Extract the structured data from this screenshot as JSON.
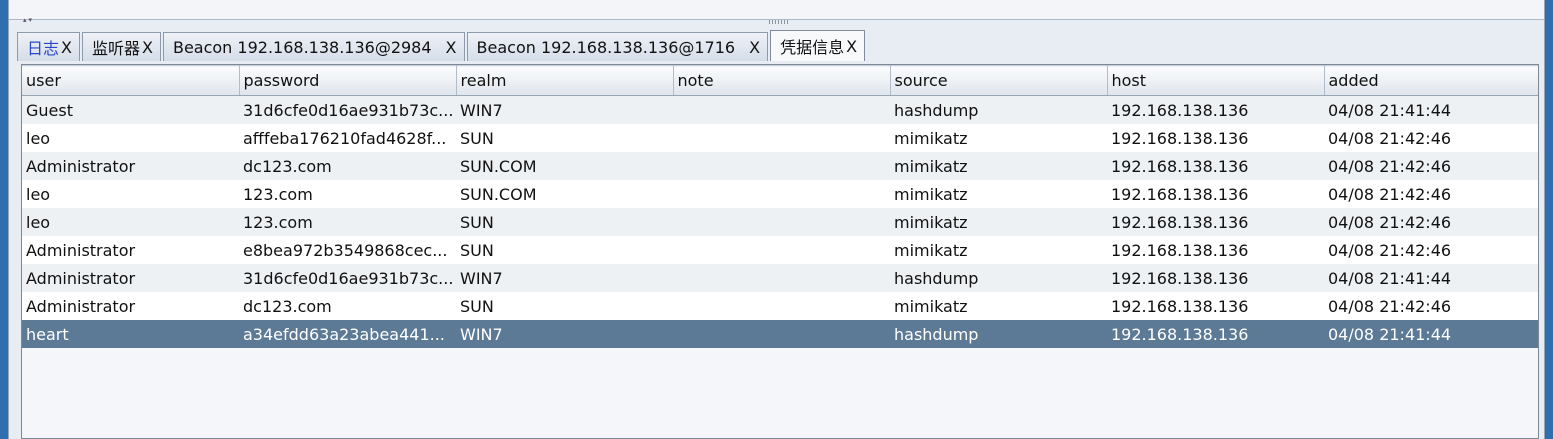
{
  "tabs": [
    {
      "label": "日志",
      "close": "X"
    },
    {
      "label": "监听器",
      "close": "X"
    },
    {
      "label": "Beacon 192.168.138.136@2984",
      "close": "X"
    },
    {
      "label": "Beacon 192.168.138.136@1716",
      "close": "X"
    },
    {
      "label": "凭据信息",
      "close": "X"
    }
  ],
  "table": {
    "columns": [
      "user",
      "password",
      "realm",
      "note",
      "source",
      "host",
      "added"
    ],
    "rows": [
      [
        "Guest",
        "31d6cfe0d16ae931b73c...",
        "WIN7",
        "",
        "hashdump",
        "192.168.138.136",
        "04/08 21:41:44"
      ],
      [
        "leo",
        "afffeba176210fad4628f...",
        "SUN",
        "",
        "mimikatz",
        "192.168.138.136",
        "04/08 21:42:46"
      ],
      [
        "Administrator",
        "dc123.com",
        "SUN.COM",
        "",
        "mimikatz",
        "192.168.138.136",
        "04/08 21:42:46"
      ],
      [
        "leo",
        "123.com",
        "SUN.COM",
        "",
        "mimikatz",
        "192.168.138.136",
        "04/08 21:42:46"
      ],
      [
        "leo",
        "123.com",
        "SUN",
        "",
        "mimikatz",
        "192.168.138.136",
        "04/08 21:42:46"
      ],
      [
        "Administrator",
        "e8bea972b3549868cec...",
        "SUN",
        "",
        "mimikatz",
        "192.168.138.136",
        "04/08 21:42:46"
      ],
      [
        "Administrator",
        "31d6cfe0d16ae931b73c...",
        "WIN7",
        "",
        "hashdump",
        "192.168.138.136",
        "04/08 21:41:44"
      ],
      [
        "Administrator",
        "dc123.com",
        "SUN",
        "",
        "mimikatz",
        "192.168.138.136",
        "04/08 21:42:46"
      ],
      [
        "heart",
        "a34efdd63a23abea441...",
        "WIN7",
        "",
        "hashdump",
        "192.168.138.136",
        "04/08 21:41:44"
      ]
    ],
    "selected_row": 8
  },
  "colors": {
    "background": "#2f6fb0",
    "selection": "#5c7a96",
    "first_tab_text": "#2b46c9"
  }
}
